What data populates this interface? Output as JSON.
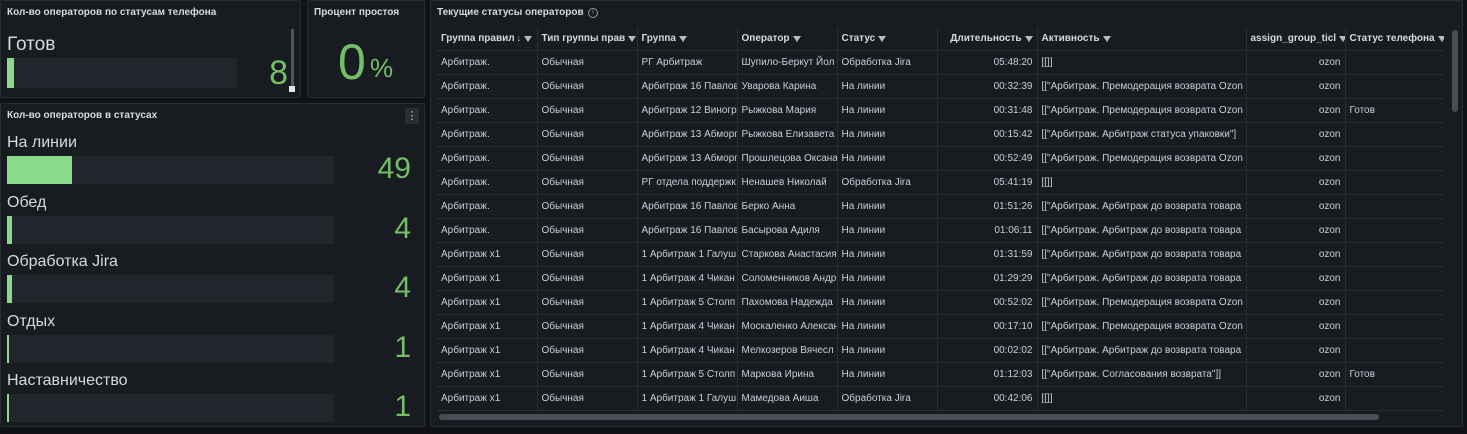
{
  "panel_ready": {
    "title": "Кол-во операторов по статусам телефона",
    "label": "Готов",
    "value": "8",
    "bar_fraction": 0.03
  },
  "panel_idle": {
    "title": "Процент простоя",
    "value": "0",
    "unit": "%"
  },
  "panel_statuses": {
    "title": "Кол-во операторов в статусах",
    "menu_icon": "kebab-menu-icon",
    "items": [
      {
        "label": "На линии",
        "value": "49",
        "bar_fraction": 0.2
      },
      {
        "label": "Обед",
        "value": "4",
        "bar_fraction": 0.016
      },
      {
        "label": "Обработка Jira",
        "value": "4",
        "bar_fraction": 0.016
      },
      {
        "label": "Отдых",
        "value": "1",
        "bar_fraction": 0.004
      },
      {
        "label": "Наставничество",
        "value": "1",
        "bar_fraction": 0.004
      }
    ]
  },
  "panel_table": {
    "title": "Текущие статусы операторов",
    "columns": [
      "Группа правил",
      "Тип группы прав",
      "Группа",
      "Оператор",
      "Статус",
      "Длительность",
      "Активность",
      "assign_group_ticl",
      "Статус телефона"
    ],
    "rows": [
      [
        "Арбитраж.",
        "Обычная",
        "РГ Арбитраж",
        "Шупило-Беркут Йол",
        "Обработка Jira",
        "05:48:20",
        "[[]]",
        "ozon",
        ""
      ],
      [
        "Арбитраж.",
        "Обычная",
        "Арбитраж 16 Павлов",
        "Уварова Карина",
        "На линии",
        "00:32:39",
        "[[\"Арбитраж. Премодерация возврата Ozon",
        "ozon",
        ""
      ],
      [
        "Арбитраж.",
        "Обычная",
        "Арбитраж 12 Виногр",
        "Рыжкова Мария",
        "На линии",
        "00:31:48",
        "[[\"Арбитраж. Премодерация возврата Ozon",
        "ozon",
        "Готов"
      ],
      [
        "Арбитраж.",
        "Обычная",
        "Арбитраж 13 Абморп",
        "Рыжкова Елизавета",
        "На линии",
        "00:15:42",
        "[[\"Арбитраж. Арбитраж статуса упаковки\"]",
        "ozon",
        ""
      ],
      [
        "Арбитраж.",
        "Обычная",
        "Арбитраж 13 Абморп",
        "Прошлецова Оксана",
        "На линии",
        "00:52:49",
        "[[\"Арбитраж. Премодерация возврата Ozon",
        "ozon",
        ""
      ],
      [
        "Арбитраж.",
        "Обычная",
        "РГ отдела поддержк",
        "Ненашев Николай",
        "Обработка Jira",
        "05:41:19",
        "[[]]",
        "ozon",
        ""
      ],
      [
        "Арбитраж.",
        "Обычная",
        "Арбитраж 16 Павлов",
        "Берко Анна",
        "На линии",
        "01:51:26",
        "[[\"Арбитраж. Арбитраж до возврата товара",
        "ozon",
        ""
      ],
      [
        "Арбитраж.",
        "Обычная",
        "Арбитраж 16 Павлов",
        "Басырова Адиля",
        "На линии",
        "01:06:11",
        "[[\"Арбитраж. Арбитраж до возврата товара",
        "ozon",
        ""
      ],
      [
        "Арбитраж x1",
        "Обычная",
        "1 Арбитраж 1 Галуш",
        "Старкова Анастасия",
        "На линии",
        "01:31:59",
        "[[\"Арбитраж. Арбитраж до возврата товара",
        "ozon",
        ""
      ],
      [
        "Арбитраж x1",
        "Обычная",
        "1 Арбитраж 4 Чикан",
        "Соломенников Андр",
        "На линии",
        "01:29:29",
        "[[\"Арбитраж. Арбитраж до возврата товара",
        "ozon",
        ""
      ],
      [
        "Арбитраж x1",
        "Обычная",
        "1 Арбитраж 5 Столп",
        "Пахомова Надежда",
        "На линии",
        "00:52:02",
        "[[\"Арбитраж. Премодерация возврата Ozon",
        "ozon",
        ""
      ],
      [
        "Арбитраж x1",
        "Обычная",
        "1 Арбитраж 4 Чикан",
        "Москаленко Алексан",
        "На линии",
        "00:17:10",
        "[[\"Арбитраж. Премодерация возврата Ozon",
        "ozon",
        ""
      ],
      [
        "Арбитраж x1",
        "Обычная",
        "1 Арбитраж 4 Чикан",
        "Мелкозеров Вячесл",
        "На линии",
        "00:02:02",
        "[[\"Арбитраж. Арбитраж до возврата товара",
        "ozon",
        ""
      ],
      [
        "Арбитраж x1",
        "Обычная",
        "1 Арбитраж 5 Столп",
        "Маркова Ирина",
        "На линии",
        "01:12:03",
        "[[\"Арбитраж. Согласования возврата\"]]",
        "ozon",
        "Готов"
      ],
      [
        "Арбитраж x1",
        "Обычная",
        "1 Арбитраж 1 Галуш",
        "Мамедова Аиша",
        "Обработка Jira",
        "00:42:06",
        "[[]]",
        "ozon",
        ""
      ]
    ]
  }
}
